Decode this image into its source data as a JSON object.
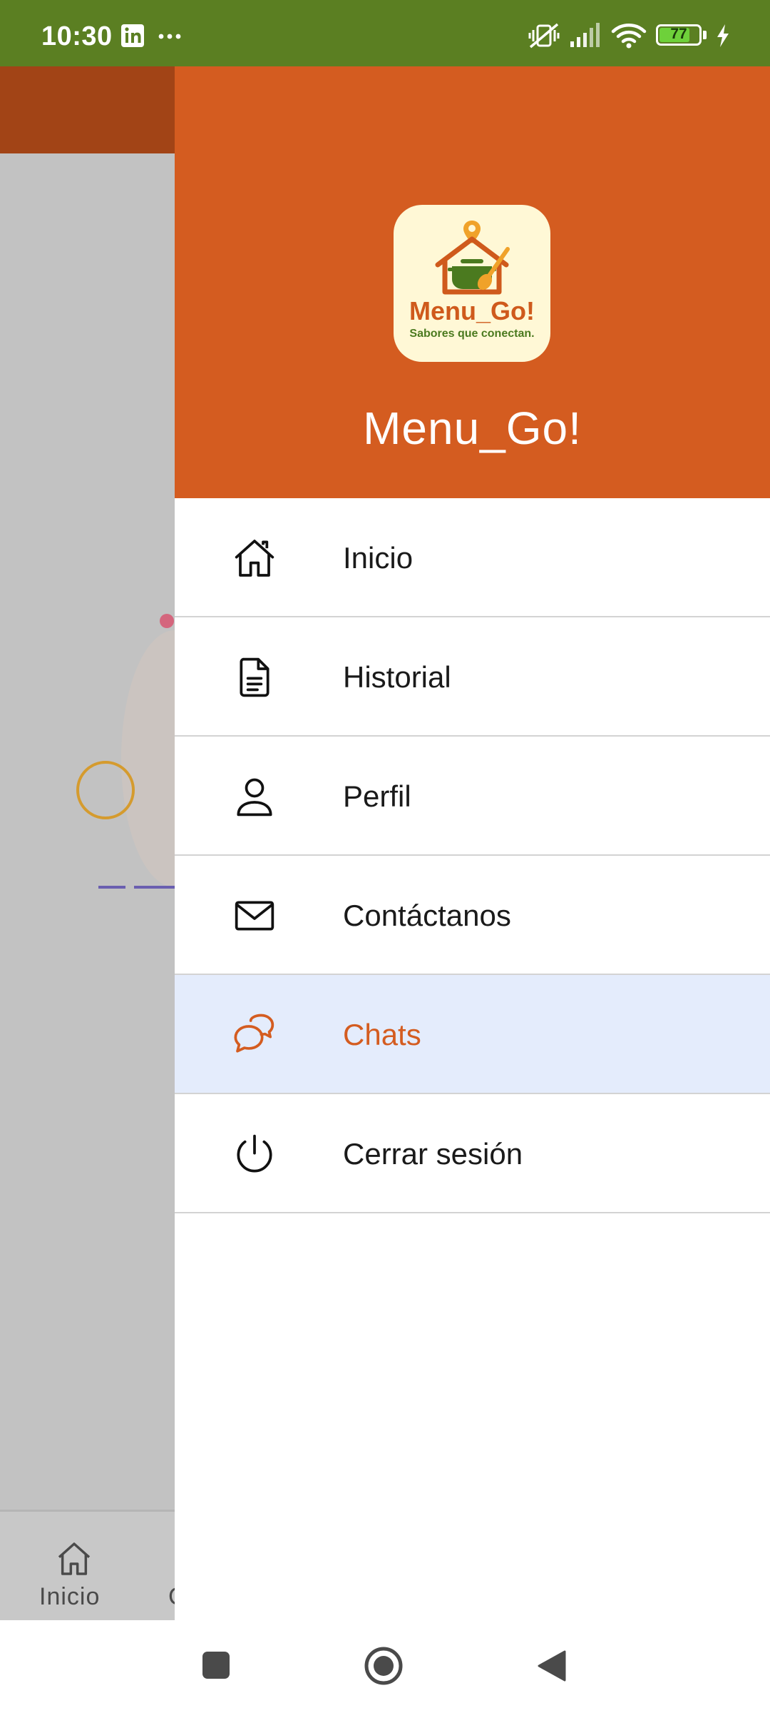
{
  "status_bar": {
    "time": "10:30",
    "battery": "77",
    "battery_level": 0.77,
    "icons": [
      "linkedin-icon",
      "more-icon",
      "vibrate-icon",
      "signal-icon",
      "wifi-icon",
      "battery-icon",
      "charging-icon"
    ]
  },
  "background_app": {
    "bottom_nav_label": "Inicio",
    "bottom_nav_partial": "C"
  },
  "drawer": {
    "logo": {
      "wordmark": "Menu_Go!",
      "tagline": "Sabores que conectan."
    },
    "title": "Menu_Go!",
    "items": [
      {
        "label": "Inicio",
        "icon": "home-icon"
      },
      {
        "label": "Historial",
        "icon": "document-icon"
      },
      {
        "label": "Perfil",
        "icon": "person-icon"
      },
      {
        "label": "Contáctanos",
        "icon": "mail-icon"
      },
      {
        "label": "Chats",
        "icon": "chat-icon",
        "active": true
      },
      {
        "label": "Cerrar sesión",
        "icon": "power-icon"
      }
    ]
  },
  "colors": {
    "status_bar": "#5b7f22",
    "header": "#d45c20",
    "active_bg": "#e4ecfc",
    "active_text": "#d45c20"
  }
}
